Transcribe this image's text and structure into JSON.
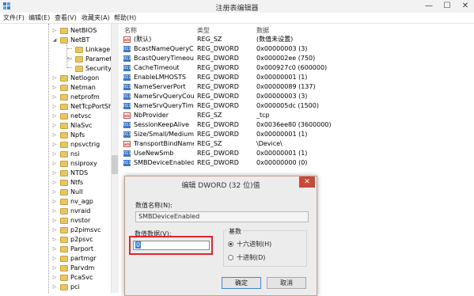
{
  "window": {
    "title": "注册表编辑器",
    "minimize_glyph": "—",
    "maximize_glyph": "☐",
    "close_glyph": "✕",
    "icon": "registry-editor-icon"
  },
  "menu": [
    "文件(F)",
    "编辑(E)",
    "查看(V)",
    "收藏夹(A)",
    "帮助(H)"
  ],
  "tree": [
    {
      "label": "NetBIOS",
      "state": "collapsed"
    },
    {
      "label": "NetBT",
      "state": "expanded"
    },
    {
      "label": "Linkage",
      "state": "child"
    },
    {
      "label": "Parameters",
      "state": "child-collapsed"
    },
    {
      "label": "Security",
      "state": "child"
    },
    {
      "label": "Netlogon",
      "state": "collapsed"
    },
    {
      "label": "Netman",
      "state": "collapsed"
    },
    {
      "label": "netprofm",
      "state": "collapsed"
    },
    {
      "label": "NetTcpPortSha",
      "state": "collapsed"
    },
    {
      "label": "netvsc",
      "state": "collapsed"
    },
    {
      "label": "NlaSvc",
      "state": "collapsed"
    },
    {
      "label": "Npfs",
      "state": "collapsed"
    },
    {
      "label": "npsvctrig",
      "state": "collapsed"
    },
    {
      "label": "nsi",
      "state": "collapsed"
    },
    {
      "label": "nsiproxy",
      "state": "collapsed"
    },
    {
      "label": "NTDS",
      "state": "collapsed"
    },
    {
      "label": "Ntfs",
      "state": "collapsed"
    },
    {
      "label": "Null",
      "state": "collapsed"
    },
    {
      "label": "nv_agp",
      "state": "collapsed"
    },
    {
      "label": "nvraid",
      "state": "collapsed"
    },
    {
      "label": "nvstor",
      "state": "collapsed"
    },
    {
      "label": "p2pimsvc",
      "state": "collapsed"
    },
    {
      "label": "p2psvc",
      "state": "collapsed"
    },
    {
      "label": "Parport",
      "state": "collapsed"
    },
    {
      "label": "partmgr",
      "state": "collapsed"
    },
    {
      "label": "Parvdm",
      "state": "collapsed"
    },
    {
      "label": "PcaSvc",
      "state": "collapsed"
    },
    {
      "label": "pci",
      "state": "collapsed"
    }
  ],
  "list": {
    "headers": {
      "name": "名称",
      "type": "类型",
      "data": "数据"
    },
    "rows": [
      {
        "icon": "ab",
        "name": "(默认)",
        "type": "REG_SZ",
        "data": "(数值未设置)"
      },
      {
        "icon": "bin",
        "name": "BcastNameQueryC...",
        "type": "REG_DWORD",
        "data": "0x00000003 (3)"
      },
      {
        "icon": "bin",
        "name": "BcastQueryTimeout",
        "type": "REG_DWORD",
        "data": "0x000002ee (750)"
      },
      {
        "icon": "bin",
        "name": "CacheTimeout",
        "type": "REG_DWORD",
        "data": "0x000927c0 (600000)"
      },
      {
        "icon": "bin",
        "name": "EnableLMHOSTS",
        "type": "REG_DWORD",
        "data": "0x00000001 (1)"
      },
      {
        "icon": "bin",
        "name": "NameServerPort",
        "type": "REG_DWORD",
        "data": "0x00000089 (137)"
      },
      {
        "icon": "bin",
        "name": "NameSrvQueryCount",
        "type": "REG_DWORD",
        "data": "0x00000003 (3)"
      },
      {
        "icon": "bin",
        "name": "NameSrvQueryTim...",
        "type": "REG_DWORD",
        "data": "0x000005dc (1500)"
      },
      {
        "icon": "ab",
        "name": "NbProvider",
        "type": "REG_SZ",
        "data": "_tcp"
      },
      {
        "icon": "bin",
        "name": "SessionKeepAlive",
        "type": "REG_DWORD",
        "data": "0x0036ee80 (3600000)"
      },
      {
        "icon": "bin",
        "name": "Size/Small/Medium...",
        "type": "REG_DWORD",
        "data": "0x00000001 (1)"
      },
      {
        "icon": "ab",
        "name": "TransportBindName",
        "type": "REG_SZ",
        "data": "\\Device\\"
      },
      {
        "icon": "bin",
        "name": "UseNewSmb",
        "type": "REG_DWORD",
        "data": "0x00000001 (1)"
      },
      {
        "icon": "bin",
        "name": "SMBDeviceEnabled",
        "type": "REG_DWORD",
        "data": "0x00000000 (0)"
      }
    ]
  },
  "dialog": {
    "title": "编辑 DWORD (32 位)值",
    "close_glyph": "✕",
    "name_label": "数值名称(N):",
    "name_value": "SMBDeviceEnabled",
    "data_label": "数值数据(V):",
    "data_value": "0",
    "radix_label": "基数",
    "hex_label": "十六进制(H)",
    "dec_label": "十进制(D)",
    "selected_radix": "hex",
    "ok_label": "确定",
    "cancel_label": "取消"
  },
  "colors": {
    "highlight_box": "#e0262b",
    "close_button": "#c9483a",
    "selection": "#3a7fd5",
    "folder": "#e9c563"
  }
}
